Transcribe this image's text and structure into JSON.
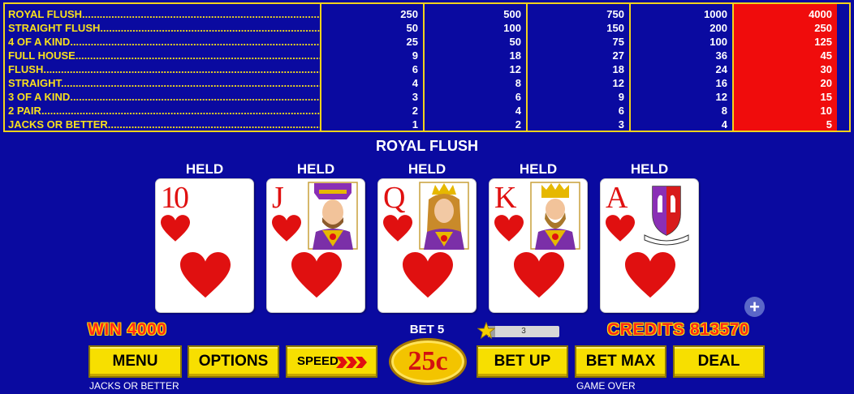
{
  "paytable": {
    "hands": [
      "ROYAL FLUSH",
      "STRAIGHT FLUSH",
      "4 OF A KIND",
      "FULL HOUSE",
      "FLUSH",
      "STRAIGHT",
      "3 OF A KIND",
      "2 PAIR",
      "JACKS OR BETTER"
    ],
    "columns": [
      [
        "250",
        "50",
        "25",
        "9",
        "6",
        "4",
        "3",
        "2",
        "1"
      ],
      [
        "500",
        "100",
        "50",
        "18",
        "12",
        "8",
        "6",
        "4",
        "2"
      ],
      [
        "750",
        "150",
        "75",
        "27",
        "18",
        "12",
        "9",
        "6",
        "3"
      ],
      [
        "1000",
        "200",
        "100",
        "36",
        "24",
        "16",
        "12",
        "8",
        "4"
      ],
      [
        "4000",
        "250",
        "125",
        "45",
        "30",
        "20",
        "15",
        "10",
        "5"
      ]
    ],
    "active_column": 4,
    "colors": {
      "border": "#f2d21b",
      "highlight": "#f00c0c",
      "background": "#0a0aa0"
    }
  },
  "hand_result": "ROYAL FLUSH",
  "cards": [
    {
      "held_label": "HELD",
      "rank": "10",
      "suit": "hearts",
      "face": null
    },
    {
      "held_label": "HELD",
      "rank": "J",
      "suit": "hearts",
      "face": "jack-face-icon"
    },
    {
      "held_label": "HELD",
      "rank": "Q",
      "suit": "hearts",
      "face": "queen-face-icon"
    },
    {
      "held_label": "HELD",
      "rank": "K",
      "suit": "hearts",
      "face": "king-face-icon"
    },
    {
      "held_label": "HELD",
      "rank": "A",
      "suit": "hearts",
      "face": "coat-of-arms-icon"
    }
  ],
  "status": {
    "win": "WIN 4000",
    "bet": "BET 5",
    "credits": "CREDITS 813570",
    "level": "3",
    "level_progress": 0.1
  },
  "buttons": {
    "menu": "MENU",
    "options": "OPTIONS",
    "speed": "SPEED",
    "denomination": "25c",
    "bet_up": "BET UP",
    "bet_max": "BET MAX",
    "deal": "DEAL"
  },
  "footer": {
    "game_name": "JACKS OR BETTER",
    "game_state": "GAME OVER"
  }
}
